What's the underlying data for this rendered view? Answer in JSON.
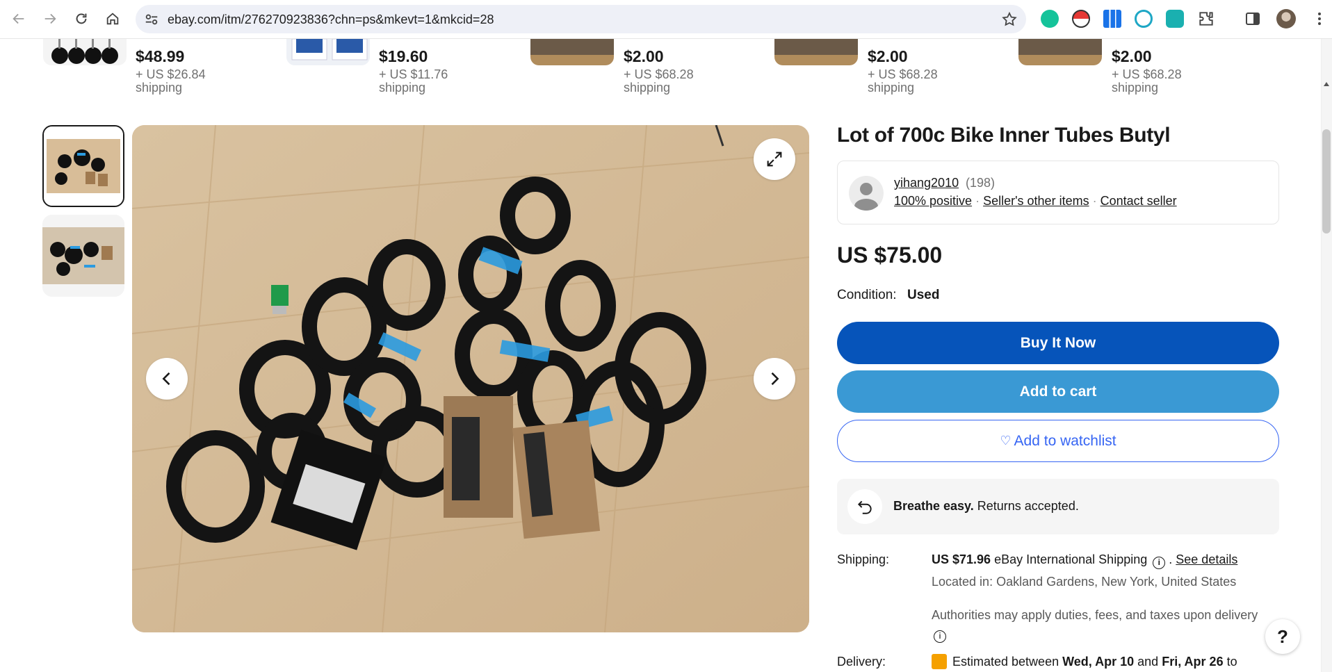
{
  "browser": {
    "url": "ebay.com/itm/276270923836?chn=ps&mkevt=1&mkcid=28"
  },
  "similar_items": [
    {
      "price": "$48.99",
      "shipping": "+ US $26.84 shipping"
    },
    {
      "price": "$19.60",
      "shipping": "+ US $11.76 shipping"
    },
    {
      "price": "$2.00",
      "shipping": "+ US $68.28 shipping"
    },
    {
      "price": "$2.00",
      "shipping": "+ US $68.28 shipping"
    },
    {
      "price": "$2.00",
      "shipping": "+ US $68.28 shipping"
    }
  ],
  "listing": {
    "title": "Lot of 700c Bike Inner Tubes Butyl",
    "price": "US $75.00",
    "condition_label": "Condition:",
    "condition_value": "Used"
  },
  "seller": {
    "name": "yihang2010",
    "feedback_count": "(198)",
    "positive": "100% positive",
    "other_items": "Seller's other items",
    "contact": "Contact seller"
  },
  "actions": {
    "buy_now": "Buy It Now",
    "add_to_cart": "Add to cart",
    "watchlist": "Add to watchlist"
  },
  "returns": {
    "bold": "Breathe easy.",
    "text": "Returns accepted."
  },
  "shipping": {
    "label": "Shipping:",
    "cost": "US $71.96",
    "method": "eBay International Shipping",
    "see_details": "See details",
    "location": "Located in: Oakland Gardens, New York, United States",
    "duties": "Authorities may apply duties, fees, and taxes upon delivery"
  },
  "delivery": {
    "label": "Delivery:",
    "prefix": "Estimated between",
    "start": "Wed, Apr 10",
    "and": "and",
    "end": "Fri, Apr 26",
    "suffix": "to"
  },
  "help": "?",
  "colors": {
    "buy_button": "#0654ba",
    "cart_button": "#3a99d4",
    "watchlist": "#3665f3",
    "omnibox": "#eef0f7"
  }
}
